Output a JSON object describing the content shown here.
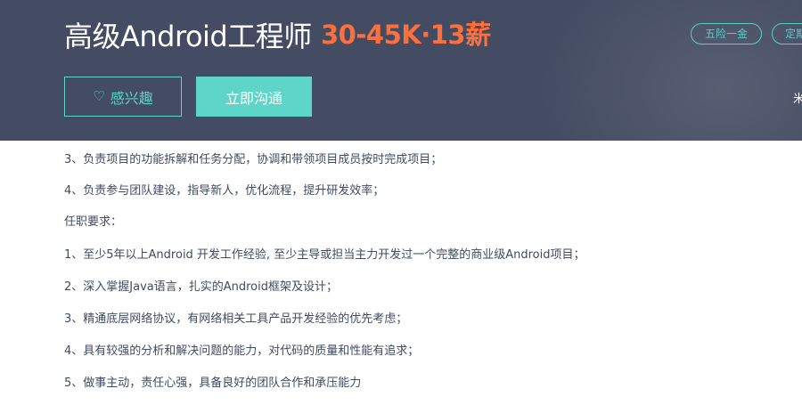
{
  "header": {
    "job_title": "高级Android工程师",
    "salary": "30-45K·13薪",
    "tags": [
      "五险一金",
      "定期"
    ],
    "interest_button": "感兴趣",
    "chat_button": "立即沟通",
    "edge_glyph": "米"
  },
  "description": {
    "lines": [
      "3、负责项目的功能拆解和任务分配，协调和带领项目成员按时完成项目；",
      "4、负责参与团队建设，指导新人，优化流程，提升研发效率；",
      "任职要求：",
      "1、至少5年以上Android 开发工作经验, 至少主导或担当主力开发过一个完整的商业级Android项目；",
      "2、深入掌握Java语言，扎实的Android框架及设计；",
      "3、精通底层网络协议，有网络相关工具产品开发经验的优先考虑；",
      "4、具有较强的分析和解决问题的能力，对代码的质量和性能有追求；",
      "5、做事主动，责任心强，具备良好的团队合作和承压能力"
    ]
  },
  "colors": {
    "header_bg": "#444c63",
    "salary": "#fc703e",
    "accent": "#5dd5c8",
    "text": "#414a60"
  }
}
